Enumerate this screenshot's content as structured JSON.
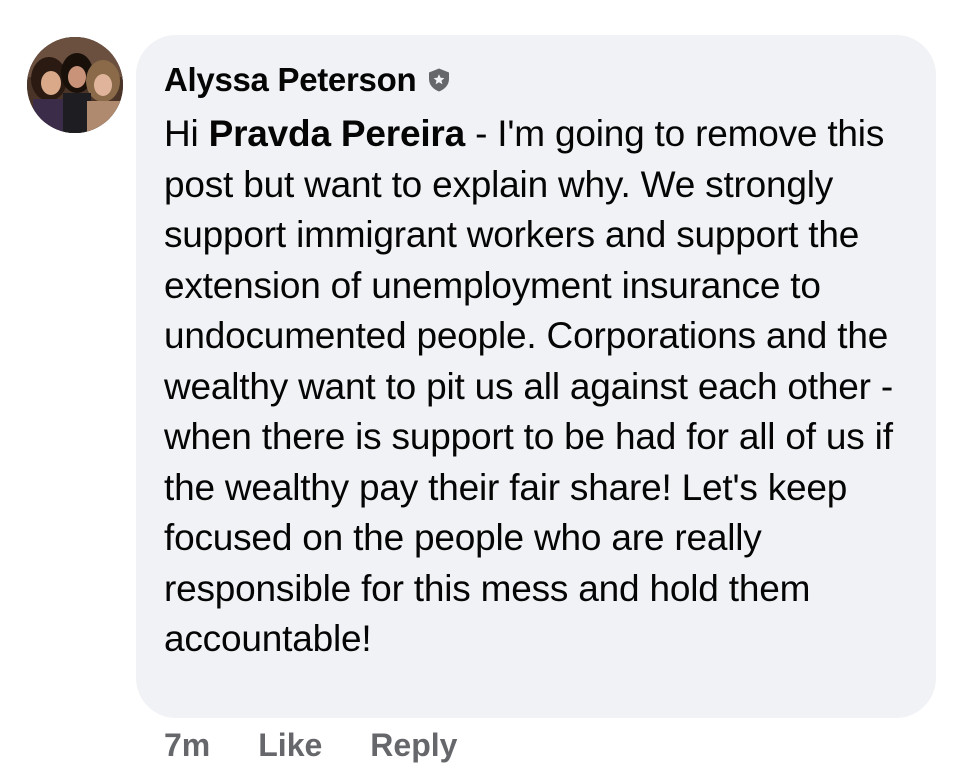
{
  "comment": {
    "author": "Alyssa Peterson",
    "badge_icon": "admin-shield-icon",
    "text_prefix": "Hi ",
    "mention": "Pravda Pereira",
    "text_body": " - I'm going to remove this post but want to explain why. We strongly support immigrant workers and support the extension of unemployment insurance to undocumented people. Corporations and the wealthy want to pit us all against each other - when there is support to be had for all of us if the wealthy pay their fair share! Let's keep focused on the people who are really responsible for this mess and hold them accountable!",
    "timestamp": "7m",
    "like_label": "Like",
    "reply_label": "Reply"
  },
  "colors": {
    "bubble_background": "#f0f2f5",
    "text": "#050505",
    "meta_text": "#65676b"
  }
}
